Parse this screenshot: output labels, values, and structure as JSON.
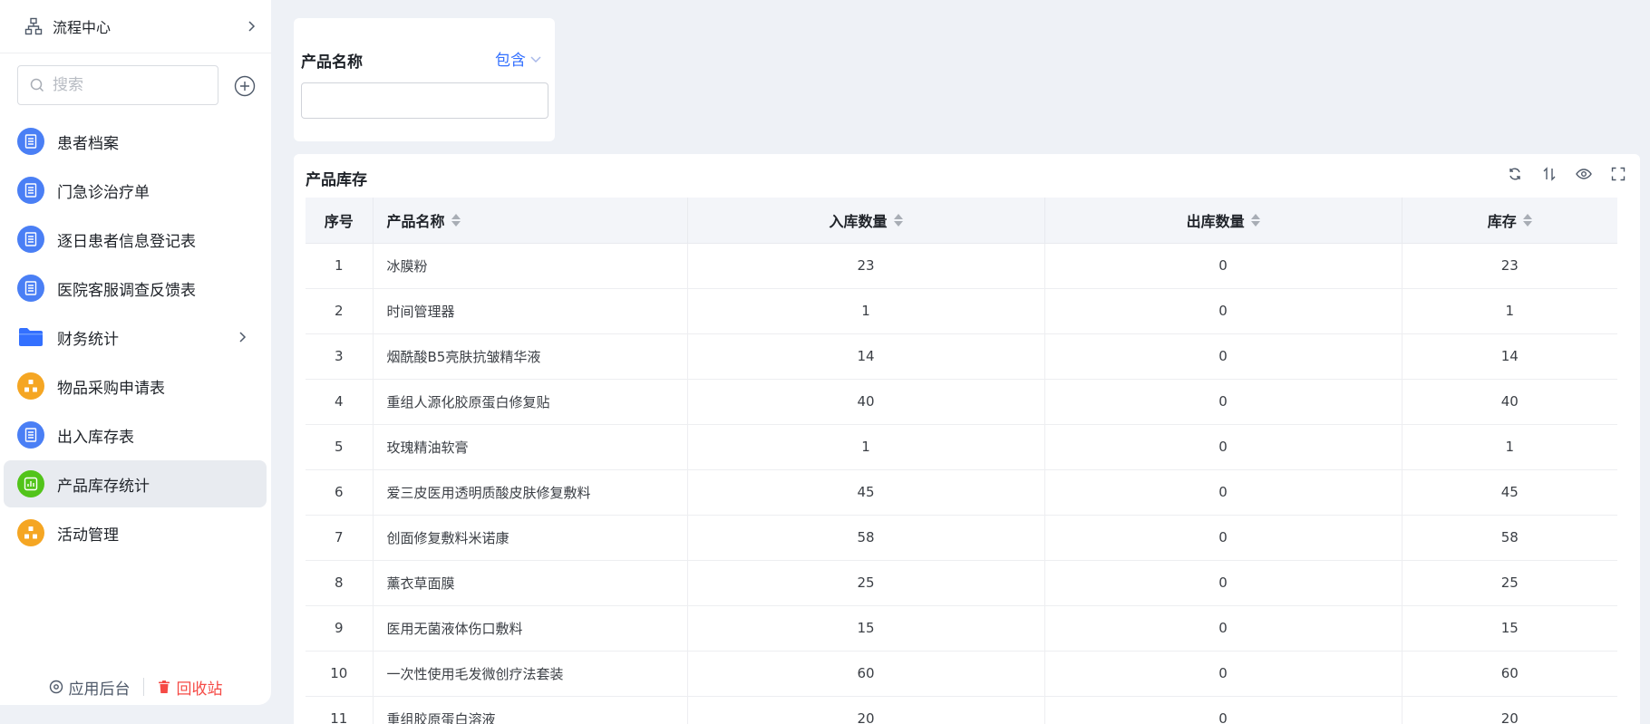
{
  "sidebar": {
    "flow_center": {
      "label": "流程中心",
      "icon": "org-chart-icon"
    },
    "search": {
      "placeholder": "搜索"
    },
    "items": [
      {
        "label": "患者档案",
        "icon": "form-icon",
        "color": "#4a7ff5"
      },
      {
        "label": "门急诊治疗单",
        "icon": "form-icon",
        "color": "#4a7ff5"
      },
      {
        "label": "逐日患者信息登记表",
        "icon": "form-icon",
        "color": "#4a7ff5"
      },
      {
        "label": "医院客服调查反馈表",
        "icon": "form-icon",
        "color": "#4a7ff5"
      },
      {
        "label": "财务统计",
        "icon": "folder-icon",
        "color": "#3370ff",
        "expandable": true
      },
      {
        "label": "物品采购申请表",
        "icon": "workflow-icon",
        "color": "#f5a623"
      },
      {
        "label": "出入库存表",
        "icon": "form-icon",
        "color": "#4a7ff5"
      },
      {
        "label": "产品库存统计",
        "icon": "chart-icon",
        "color": "#52c41a",
        "active": true
      },
      {
        "label": "活动管理",
        "icon": "workflow-icon",
        "color": "#f5a623"
      }
    ],
    "footer": {
      "admin_label": "应用后台",
      "trash_label": "回收站"
    }
  },
  "filter": {
    "field_label": "产品名称",
    "operator": "包含",
    "value": ""
  },
  "table": {
    "title": "产品库存",
    "toolbar": [
      "refresh-icon",
      "sort-icon",
      "eye-icon",
      "fullscreen-icon"
    ],
    "columns": [
      "序号",
      "产品名称",
      "入库数量",
      "出库数量",
      "库存"
    ],
    "rows": [
      [
        "1",
        "冰膜粉",
        "23",
        "0",
        "23"
      ],
      [
        "2",
        "时间管理器",
        "1",
        "0",
        "1"
      ],
      [
        "3",
        "烟酰酸B5亮肤抗皱精华液",
        "14",
        "0",
        "14"
      ],
      [
        "4",
        "重组人源化胶原蛋白修复贴",
        "40",
        "0",
        "40"
      ],
      [
        "5",
        "玫瑰精油软膏",
        "1",
        "0",
        "1"
      ],
      [
        "6",
        "爱三皮医用透明质酸皮肤修复敷料",
        "45",
        "0",
        "45"
      ],
      [
        "7",
        "创面修复敷料米诺康",
        "58",
        "0",
        "58"
      ],
      [
        "8",
        "薰衣草面膜",
        "25",
        "0",
        "25"
      ],
      [
        "9",
        "医用无菌液体伤口敷料",
        "15",
        "0",
        "15"
      ],
      [
        "10",
        "一次性使用毛发微创疗法套装",
        "60",
        "0",
        "60"
      ],
      [
        "11",
        "重组胶原蛋白溶液",
        "20",
        "0",
        "20"
      ]
    ]
  },
  "colors": {
    "accent": "#3370ff",
    "danger": "#f54a45",
    "background": "#eef1f6"
  }
}
